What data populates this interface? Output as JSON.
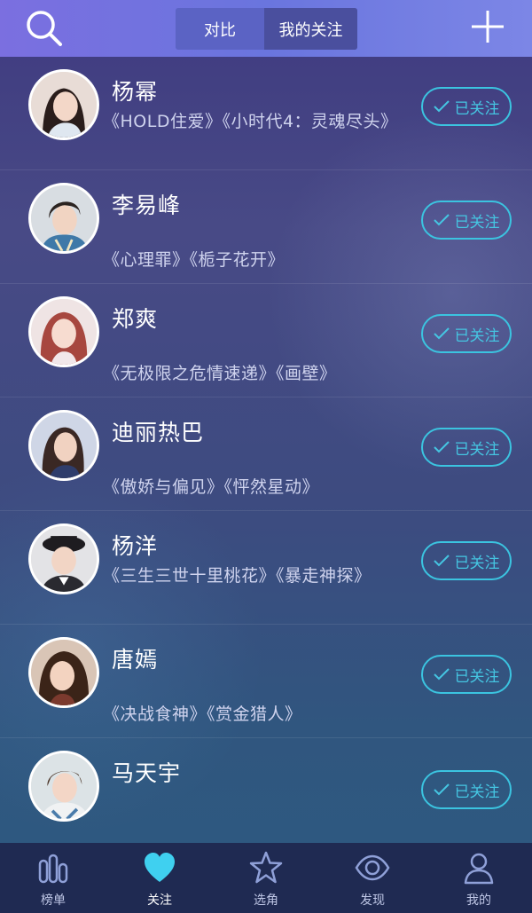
{
  "header": {
    "tabs": [
      {
        "label": "对比",
        "active": false
      },
      {
        "label": "我的关注",
        "active": true
      }
    ]
  },
  "colors": {
    "accent": "#3bc4e0",
    "header_start": "#7b6fe0",
    "header_end": "#7c86e6",
    "tabbar": "#1f2a52",
    "active_heart": "#3fd0f0"
  },
  "follow_label": "已关注",
  "celebrities": [
    {
      "name": "杨幂",
      "works": "《HOLD住爱》《小时代4：灵魂尽头》"
    },
    {
      "name": "李易峰",
      "works": "《心理罪》《栀子花开》"
    },
    {
      "name": "郑爽",
      "works": "《无极限之危情速递》《画壁》"
    },
    {
      "name": "迪丽热巴",
      "works": "《傲娇与偏见》《怦然星动》"
    },
    {
      "name": "杨洋",
      "works": "《三生三世十里桃花》《暴走神探》"
    },
    {
      "name": "唐嫣",
      "works": "《决战食神》《赏金猎人》"
    },
    {
      "name": "马天宇",
      "works": ""
    }
  ],
  "tabbar": {
    "items": [
      {
        "label": "榜单",
        "icon": "chart-bars-icon",
        "active": false
      },
      {
        "label": "关注",
        "icon": "heart-icon",
        "active": true
      },
      {
        "label": "选角",
        "icon": "star-icon",
        "active": false
      },
      {
        "label": "发现",
        "icon": "eye-icon",
        "active": false
      },
      {
        "label": "我的",
        "icon": "person-icon",
        "active": false
      }
    ]
  }
}
